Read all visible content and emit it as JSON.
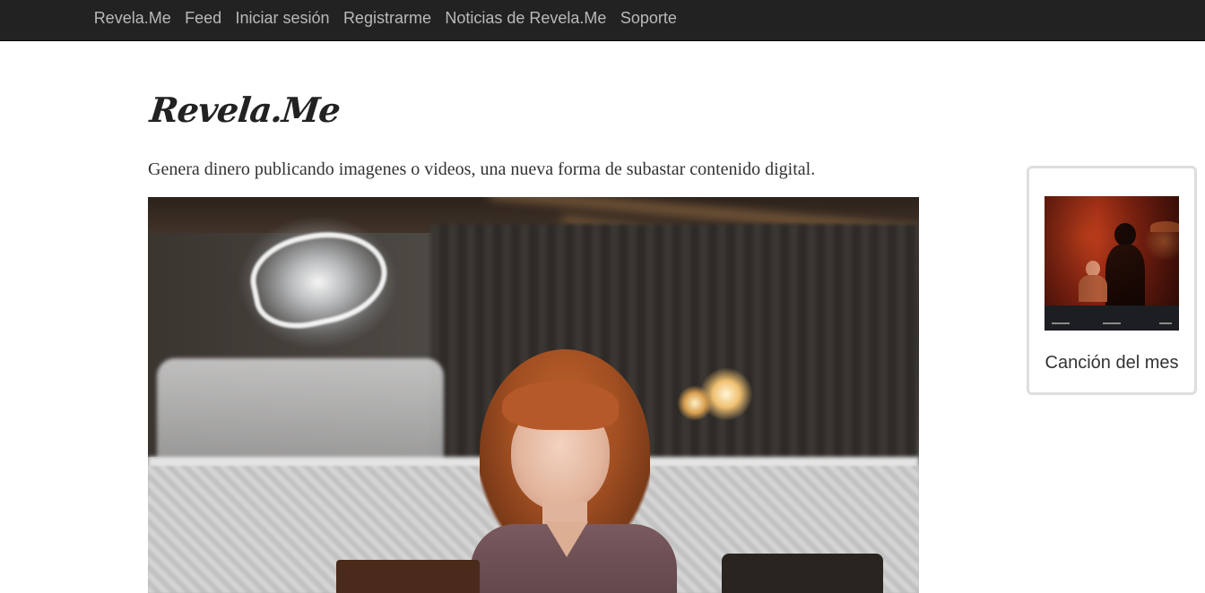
{
  "nav": {
    "items": [
      {
        "label": "Revela.Me"
      },
      {
        "label": "Feed"
      },
      {
        "label": "Iniciar sesión"
      },
      {
        "label": "Registrarme"
      },
      {
        "label": "Noticias de Revela.Me"
      },
      {
        "label": "Soporte"
      }
    ]
  },
  "main": {
    "title": "Revela.Me",
    "tagline": "Genera dinero publicando imagenes o videos, una nueva forma de subastar contenido digital."
  },
  "sidebar": {
    "song_card": {
      "label": "Canción del mes"
    }
  },
  "colors": {
    "navbar_bg": "#222222",
    "nav_text": "#b9b9b9",
    "body_text": "#333333",
    "card_border": "#dedede"
  }
}
